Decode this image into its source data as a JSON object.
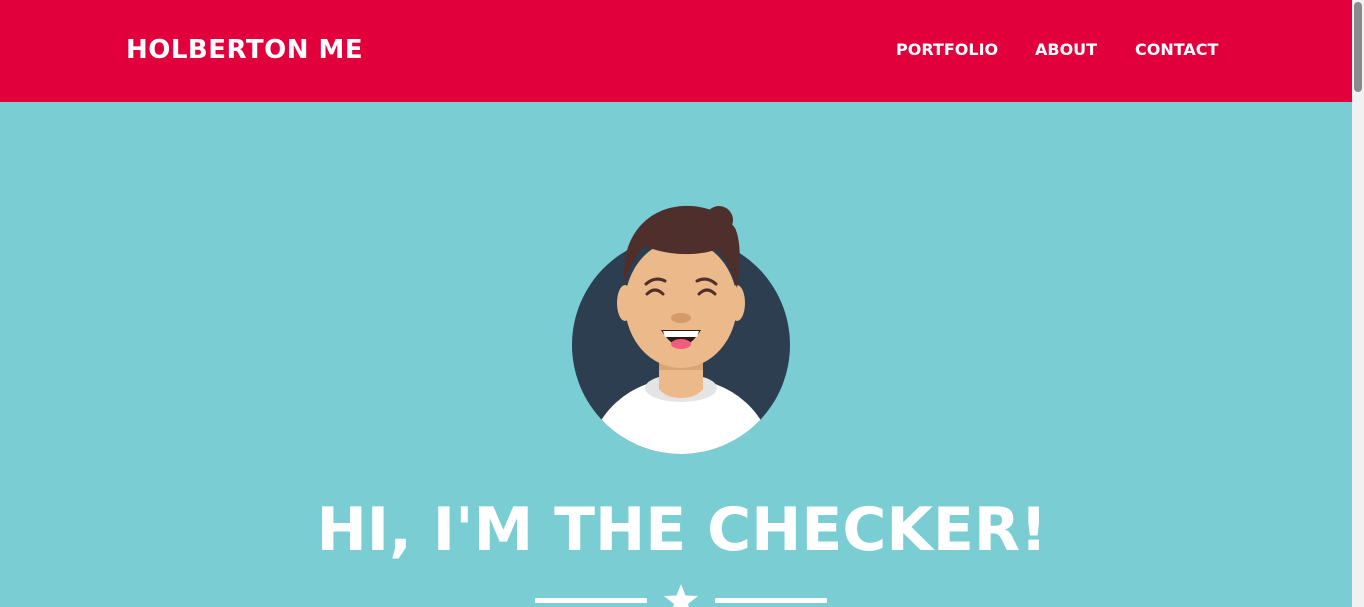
{
  "header": {
    "brand": "HOLBERTON ME",
    "nav": [
      {
        "label": "PORTFOLIO"
      },
      {
        "label": "ABOUT"
      },
      {
        "label": "CONTACT"
      }
    ]
  },
  "hero": {
    "title": "HI, I'M THE CHECKER!",
    "avatar_icon": "smiling-man-avatar",
    "divider_icon": "star-icon"
  },
  "colors": {
    "header_bg": "#e1003b",
    "page_bg": "#79cdd3",
    "text": "#ffffff",
    "avatar_circle": "#2c3e50"
  }
}
